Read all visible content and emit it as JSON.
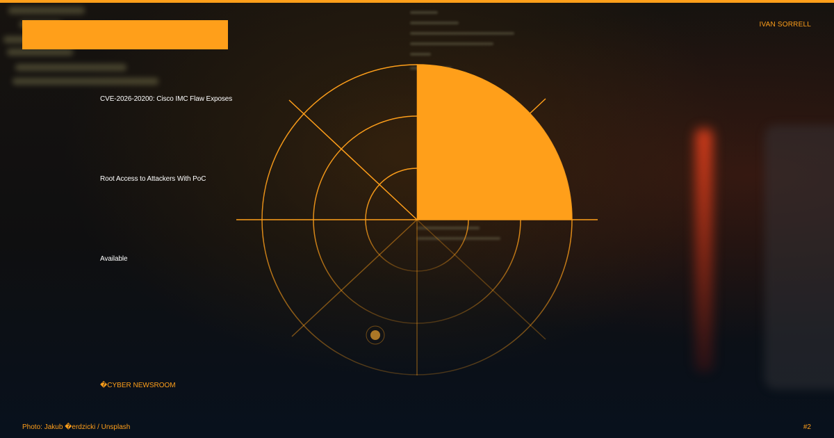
{
  "author": "IVAN SORRELL",
  "headline_lines": [
    "CVE-2026-20200: Cisco IMC Flaw Exposes",
    "Root Access to Attackers With PoC",
    "Available"
  ],
  "brand": "�CYBER NEWSROOM",
  "photo_credit": "Photo: Jakub �erdzicki / Unsplash",
  "page_number": "#2",
  "colors": {
    "accent": "#ff9f1a",
    "text": "#ffffff",
    "background": "#0f0f10"
  },
  "icons": {
    "radar": "radar-graphic"
  }
}
